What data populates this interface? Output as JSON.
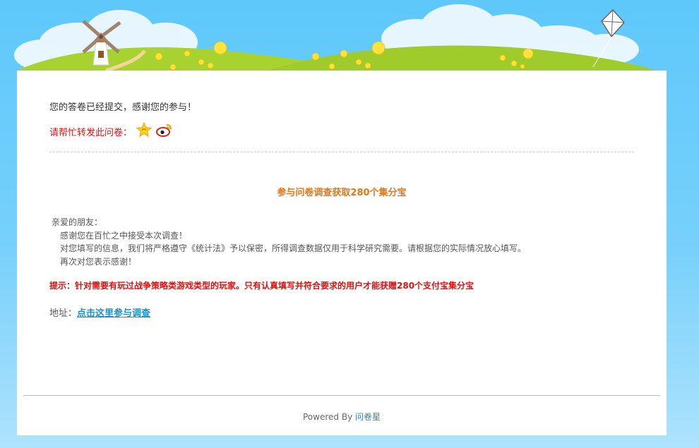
{
  "confirmation": {
    "message": "您的答卷已经提交，感谢您的参与！"
  },
  "share": {
    "label": "请帮忙转发此问卷：",
    "icons": [
      "qzone-star-icon",
      "weibo-icon"
    ]
  },
  "survey": {
    "title": "参与问卷调查获取280个集分宝",
    "greeting": "亲爱的朋友：",
    "lines": [
      "感谢您在百忙之中接受本次调查！",
      "对您填写的信息，我们将严格遵守《统计法》予以保密，所得调查数据仅用于科学研究需要。请根据您的实际情况放心填写。",
      "再次对您表示感谢！"
    ],
    "tip": "提示：针对需要有玩过战争策略类游戏类型的玩家。只有认真填写并符合要求的用户才能获赠280个支付宝集分宝",
    "address_label": "地址：",
    "address_link": "点击这里参与调查"
  },
  "footer": {
    "powered_by": "Powered By ",
    "brand": "问卷星"
  },
  "colors": {
    "sky": "#5ec8fb",
    "grass": "#a4cf2e",
    "accent_red": "#e01010",
    "accent_orange": "#e4761a",
    "link_blue": "#1b8fc9"
  }
}
